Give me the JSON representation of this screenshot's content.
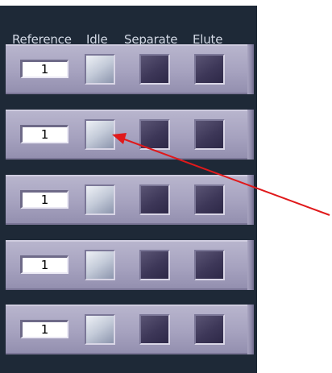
{
  "headers": {
    "reference": "Reference",
    "idle": "Idle",
    "separate": "Separate",
    "elute": "Elute"
  },
  "rows": [
    {
      "reference": "1",
      "idle": "on",
      "separate": "off",
      "elute": "off"
    },
    {
      "reference": "1",
      "idle": "on",
      "separate": "off",
      "elute": "off"
    },
    {
      "reference": "1",
      "idle": "on",
      "separate": "off",
      "elute": "off"
    },
    {
      "reference": "1",
      "idle": "on",
      "separate": "off",
      "elute": "off"
    },
    {
      "reference": "1",
      "idle": "on",
      "separate": "off",
      "elute": "off"
    }
  ],
  "colors": {
    "panel": "#1e2937",
    "row": "#a6a2bf",
    "indicator_on": "#c3cad8",
    "indicator_off": "#3d3758",
    "annotation_arrow": "#e0191b"
  },
  "annotation": {
    "icon": "arrow-icon",
    "target": "row 2 idle indicator"
  }
}
